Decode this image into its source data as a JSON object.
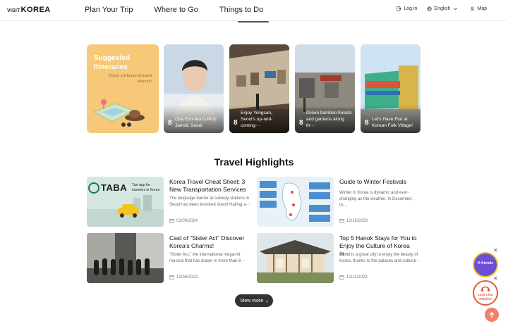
{
  "header": {
    "logo_visit": "VISIT",
    "logo_korea": "KOREA",
    "nav": [
      "Plan Your Trip",
      "Where to Go",
      "Things to Do"
    ],
    "login": "Log in",
    "language": "English",
    "map": "Map"
  },
  "promo": {
    "title": "Suggested Itineraries",
    "subtitle": "Check out featured travel courses!"
  },
  "itineraries": [
    {
      "num": "8",
      "caption": "Cha Eun-woo's Pick: Jamsil, Seoul"
    },
    {
      "num": "8",
      "caption": "Enjoy Yongsan, Seoul's up-and-coming···"
    },
    {
      "num": "8",
      "caption": "Green bamboo forests and gardens along th···"
    },
    {
      "num": "8",
      "caption": "Let's Have Fun at Korean Folk Village!"
    }
  ],
  "highlights_title": "Travel Highlights",
  "highlights": [
    {
      "title": "Korea Travel Cheat Sheet: 3 New Transportation Services",
      "desc": "The language barrier at subway stations in Seoul has been knocked down! Hailing a···",
      "date": "01/09/2024",
      "thumb_brand": "TABA",
      "thumb_text": "Taxi app for travelers in Korea"
    },
    {
      "title": "Guide to Winter Festivals",
      "desc": "Winter in Korea is dynamic and ever-changing as the weather. In December, th···",
      "date": "12/15/2023"
    },
    {
      "title": "Cast of “Sister Act” Discover Korea’s Charms!",
      "desc": "“Sister Act,” the international mega-hit musical that has drawn in more than 6···",
      "date": "12/06/2023"
    },
    {
      "title": "Top 5 Hanok Stays for You to Enjoy the Culture of Korea in···",
      "desc": "Seoul is a great city to enjoy the beauty of Korea, thanks to the palaces and cultural···",
      "date": "12/11/2023"
    }
  ],
  "view_more": "View more",
  "kfriends": "K-friends",
  "helpline": "1330 Chat Helpline",
  "colors": {
    "promo_bg": "#f6c877",
    "scroll_top": "#f0806b",
    "kfriends": "#6c4fd8",
    "helpline_ring": "#e25b3a",
    "view_more_bg": "#333333"
  }
}
